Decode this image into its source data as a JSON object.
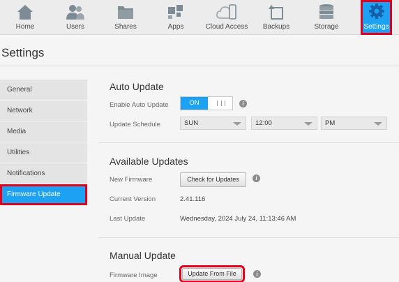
{
  "nav": {
    "items": [
      {
        "label": "Home",
        "icon": "home-icon"
      },
      {
        "label": "Users",
        "icon": "users-icon"
      },
      {
        "label": "Shares",
        "icon": "folder-icon"
      },
      {
        "label": "Apps",
        "icon": "apps-icon"
      },
      {
        "label": "Cloud Access",
        "icon": "cloud-phone-icon"
      },
      {
        "label": "Backups",
        "icon": "backup-icon"
      },
      {
        "label": "Storage",
        "icon": "storage-icon"
      },
      {
        "label": "Settings",
        "icon": "gear-icon"
      }
    ],
    "active": "Settings"
  },
  "page": {
    "title": "Settings"
  },
  "sidebar": {
    "items": [
      {
        "label": "General"
      },
      {
        "label": "Network"
      },
      {
        "label": "Media"
      },
      {
        "label": "Utilities"
      },
      {
        "label": "Notifications"
      },
      {
        "label": "Firmware Update"
      }
    ],
    "active": "Firmware Update"
  },
  "auto_update": {
    "title": "Auto Update",
    "enable_label": "Enable Auto Update",
    "toggle_on": "ON",
    "schedule_label": "Update Schedule",
    "day": "SUN",
    "time": "12:00",
    "ampm": "PM"
  },
  "available": {
    "title": "Available Updates",
    "new_fw_label": "New Firmware",
    "check_button": "Check for Updates",
    "current_label": "Current Version",
    "current_value": "2.41.116",
    "last_label": "Last Update",
    "last_value": "Wednesday, 2024 July 24, 11:13:46 AM"
  },
  "manual": {
    "title": "Manual Update",
    "image_label": "Firmware Image",
    "upload_button": "Update From File"
  },
  "info_glyph": "i",
  "colors": {
    "accent": "#1da1f2",
    "highlight": "#e3001b"
  }
}
